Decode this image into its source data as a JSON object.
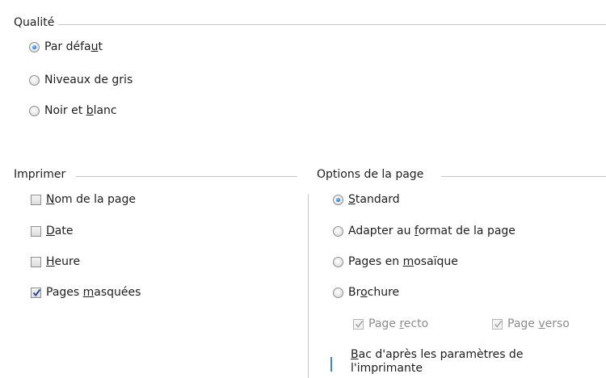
{
  "quality": {
    "title": "Qualité",
    "options": [
      {
        "pre": "Par défa",
        "acc": "u",
        "post": "t",
        "checked": true
      },
      {
        "pre": "Niveaux de ",
        "acc": "g",
        "post": "ris",
        "checked": false
      },
      {
        "pre": "Noir et ",
        "acc": "b",
        "post": "lanc",
        "checked": false
      }
    ]
  },
  "print": {
    "title": "Imprimer",
    "items": [
      {
        "pre": "",
        "acc": "N",
        "post": "om de la page",
        "checked": false
      },
      {
        "pre": "",
        "acc": "D",
        "post": "ate",
        "checked": false
      },
      {
        "pre": "",
        "acc": "H",
        "post": "eure",
        "checked": false
      },
      {
        "pre": "Pages ",
        "acc": "m",
        "post": "asquées",
        "checked": true
      }
    ]
  },
  "page_options": {
    "title": "Options de la page",
    "options": [
      {
        "pre": "",
        "acc": "S",
        "post": "tandard",
        "checked": true
      },
      {
        "pre": "Adapter au ",
        "acc": "f",
        "post": "ormat de la page",
        "checked": false
      },
      {
        "pre": "Pages en ",
        "acc": "m",
        "post": "osaïque",
        "checked": false
      },
      {
        "pre": "Br",
        "acc": "o",
        "post": "chure",
        "checked": false
      }
    ],
    "recto": {
      "pre": "Page ",
      "acc": "r",
      "post": "ecto",
      "checked": true
    },
    "verso": {
      "pre": "Page ",
      "acc": "v",
      "post": "erso",
      "checked": true
    },
    "tray": {
      "acc": "B",
      "line1_post": "ac d'après les paramètres de",
      "line2": "l'imprimante",
      "checked": false
    }
  }
}
